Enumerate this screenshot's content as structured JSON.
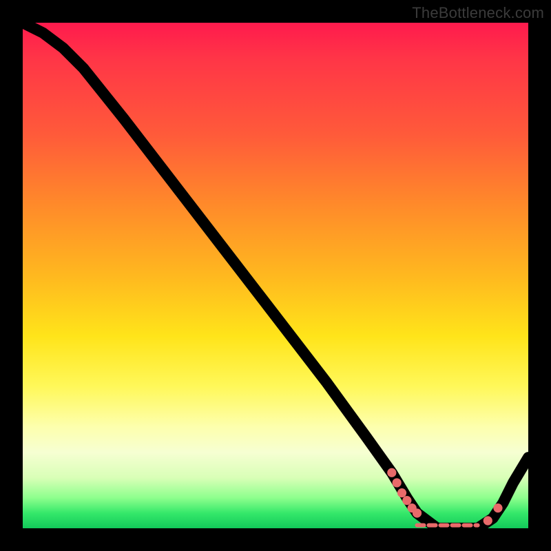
{
  "watermark": "TheBottleneck.com",
  "chart_data": {
    "type": "line",
    "title": "",
    "xlabel": "",
    "ylabel": "",
    "xlim": [
      0,
      100
    ],
    "ylim": [
      0,
      100
    ],
    "grid": false,
    "series": [
      {
        "name": "bottleneck-curve",
        "x": [
          0,
          4,
          8,
          12,
          16,
          20,
          30,
          40,
          50,
          60,
          68,
          73,
          76,
          78,
          82,
          86,
          90,
          93,
          95,
          97,
          100
        ],
        "y": [
          100,
          98,
          95,
          91,
          86,
          81,
          68,
          55,
          42,
          29,
          18,
          11,
          6,
          3,
          0,
          0,
          0,
          2,
          5,
          9,
          14
        ],
        "color": "#000000"
      }
    ],
    "markers": {
      "name": "highlight-dots",
      "color": "#e86a6a",
      "points": [
        {
          "x": 73,
          "y": 11
        },
        {
          "x": 74,
          "y": 9
        },
        {
          "x": 75,
          "y": 7
        },
        {
          "x": 76,
          "y": 5.5
        },
        {
          "x": 77,
          "y": 4
        },
        {
          "x": 78,
          "y": 3
        },
        {
          "x": 92,
          "y": 1.5
        },
        {
          "x": 94,
          "y": 4
        }
      ],
      "flat_segment": {
        "x_start": 78,
        "x_end": 90,
        "y": 0
      }
    }
  }
}
